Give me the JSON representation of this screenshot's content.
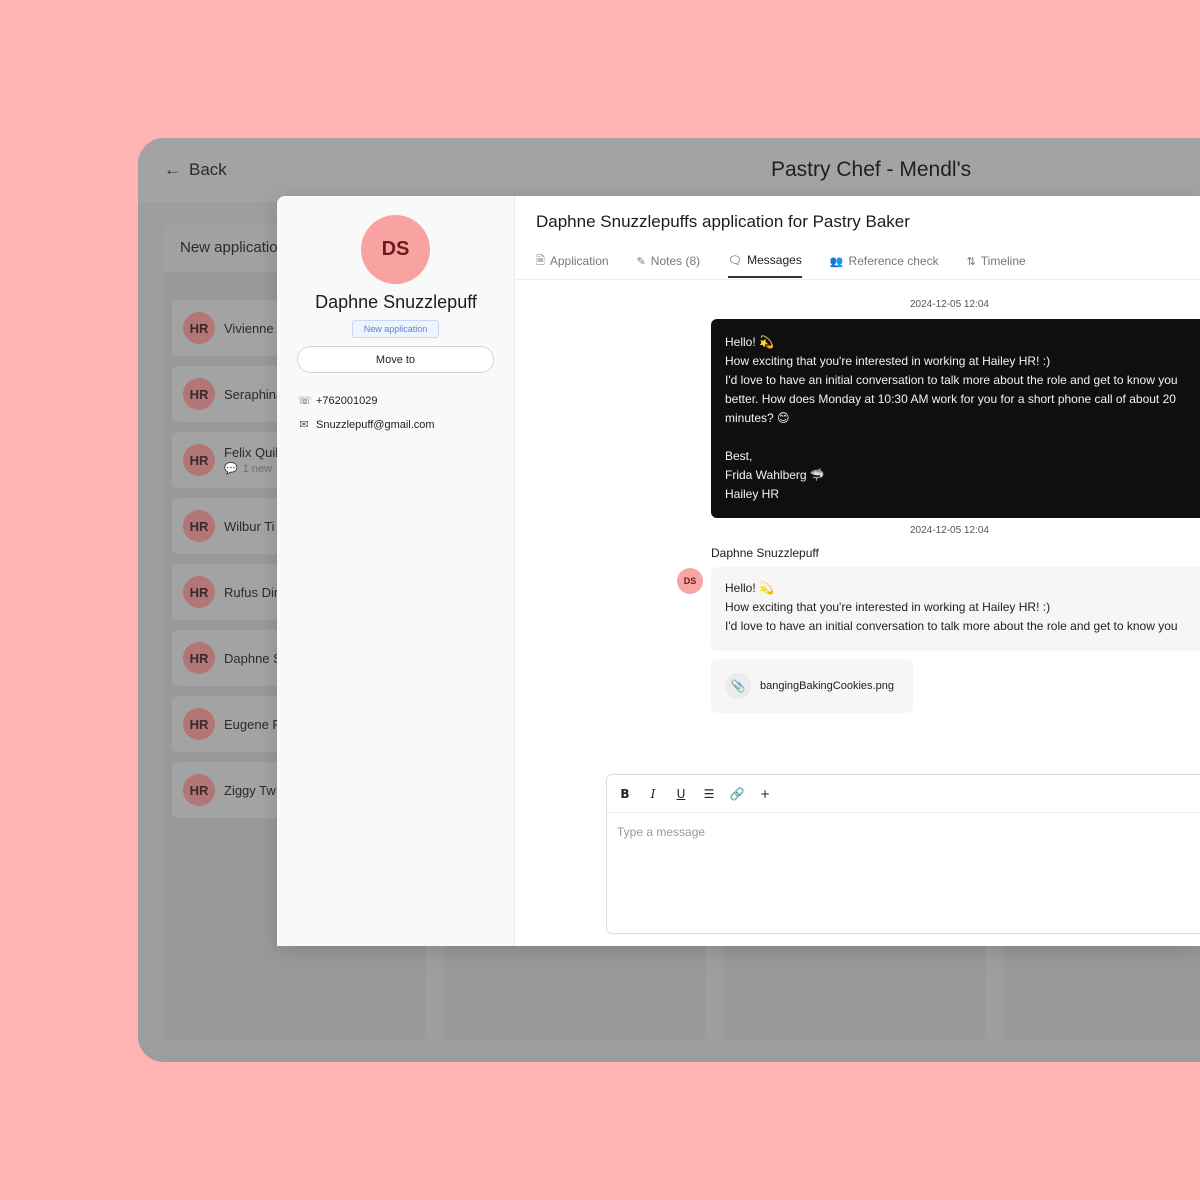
{
  "window": {
    "back_label": "Back",
    "title": "Pastry Chef - Mendl's"
  },
  "board": {
    "column_header": "New applications",
    "candidates": [
      {
        "initials": "HR",
        "name": "Vivienne"
      },
      {
        "initials": "HR",
        "name": "Seraphina"
      },
      {
        "initials": "HR",
        "name": "Felix Quill",
        "sub": "1 new"
      },
      {
        "initials": "HR",
        "name": "Wilbur Ti"
      },
      {
        "initials": "HR",
        "name": "Rufus Dir"
      },
      {
        "initials": "HR",
        "name": "Daphne S"
      },
      {
        "initials": "HR",
        "name": "Eugene F"
      },
      {
        "initials": "HR",
        "name": "Ziggy Tw"
      }
    ]
  },
  "profile": {
    "initials": "DS",
    "name": "Daphne Snuzzlepuff",
    "status": "New application",
    "move_label": "Move to",
    "phone": "+762001029",
    "email": "Snuzzlepuff@gmail.com"
  },
  "content": {
    "title": "Daphne Snuzzlepuffs application for Pastry Baker",
    "tabs": [
      {
        "label": "Application",
        "icon": "document-icon"
      },
      {
        "label": "Notes (8)",
        "icon": "pencil-icon"
      },
      {
        "label": "Messages",
        "icon": "chat-icon"
      },
      {
        "label": "Reference check",
        "icon": "people-icon"
      },
      {
        "label": "Timeline",
        "icon": "timeline-icon"
      }
    ],
    "messages": {
      "timestamp_1": "2024-12-05 12:04",
      "outgoing_text": "Hello! 💫\nHow exciting that you're interested in working at Hailey HR! :)\nI'd love to have an initial conversation to talk more about the role and get to know you\nbetter. How does Monday at 10:30 AM work for you for a short phone call of about 20\nminutes? 😊\n\nBest,\nFrida Wahlberg 🦈\nHailey HR",
      "timestamp_2": "2024-12-05 12:04",
      "sender_name": "Daphne Snuzzlepuff",
      "sender_initials": "DS",
      "reply_line_1": "Hello! 💫",
      "reply_line_2": "How exciting that you're interested in working at Hailey HR! :)",
      "reply_line_3": "I'd love to have an initial conversation to talk more about the role and get to know you",
      "attachment_name": "bangingBakingCookies.png"
    },
    "editor": {
      "placeholder": "Type a message"
    }
  }
}
